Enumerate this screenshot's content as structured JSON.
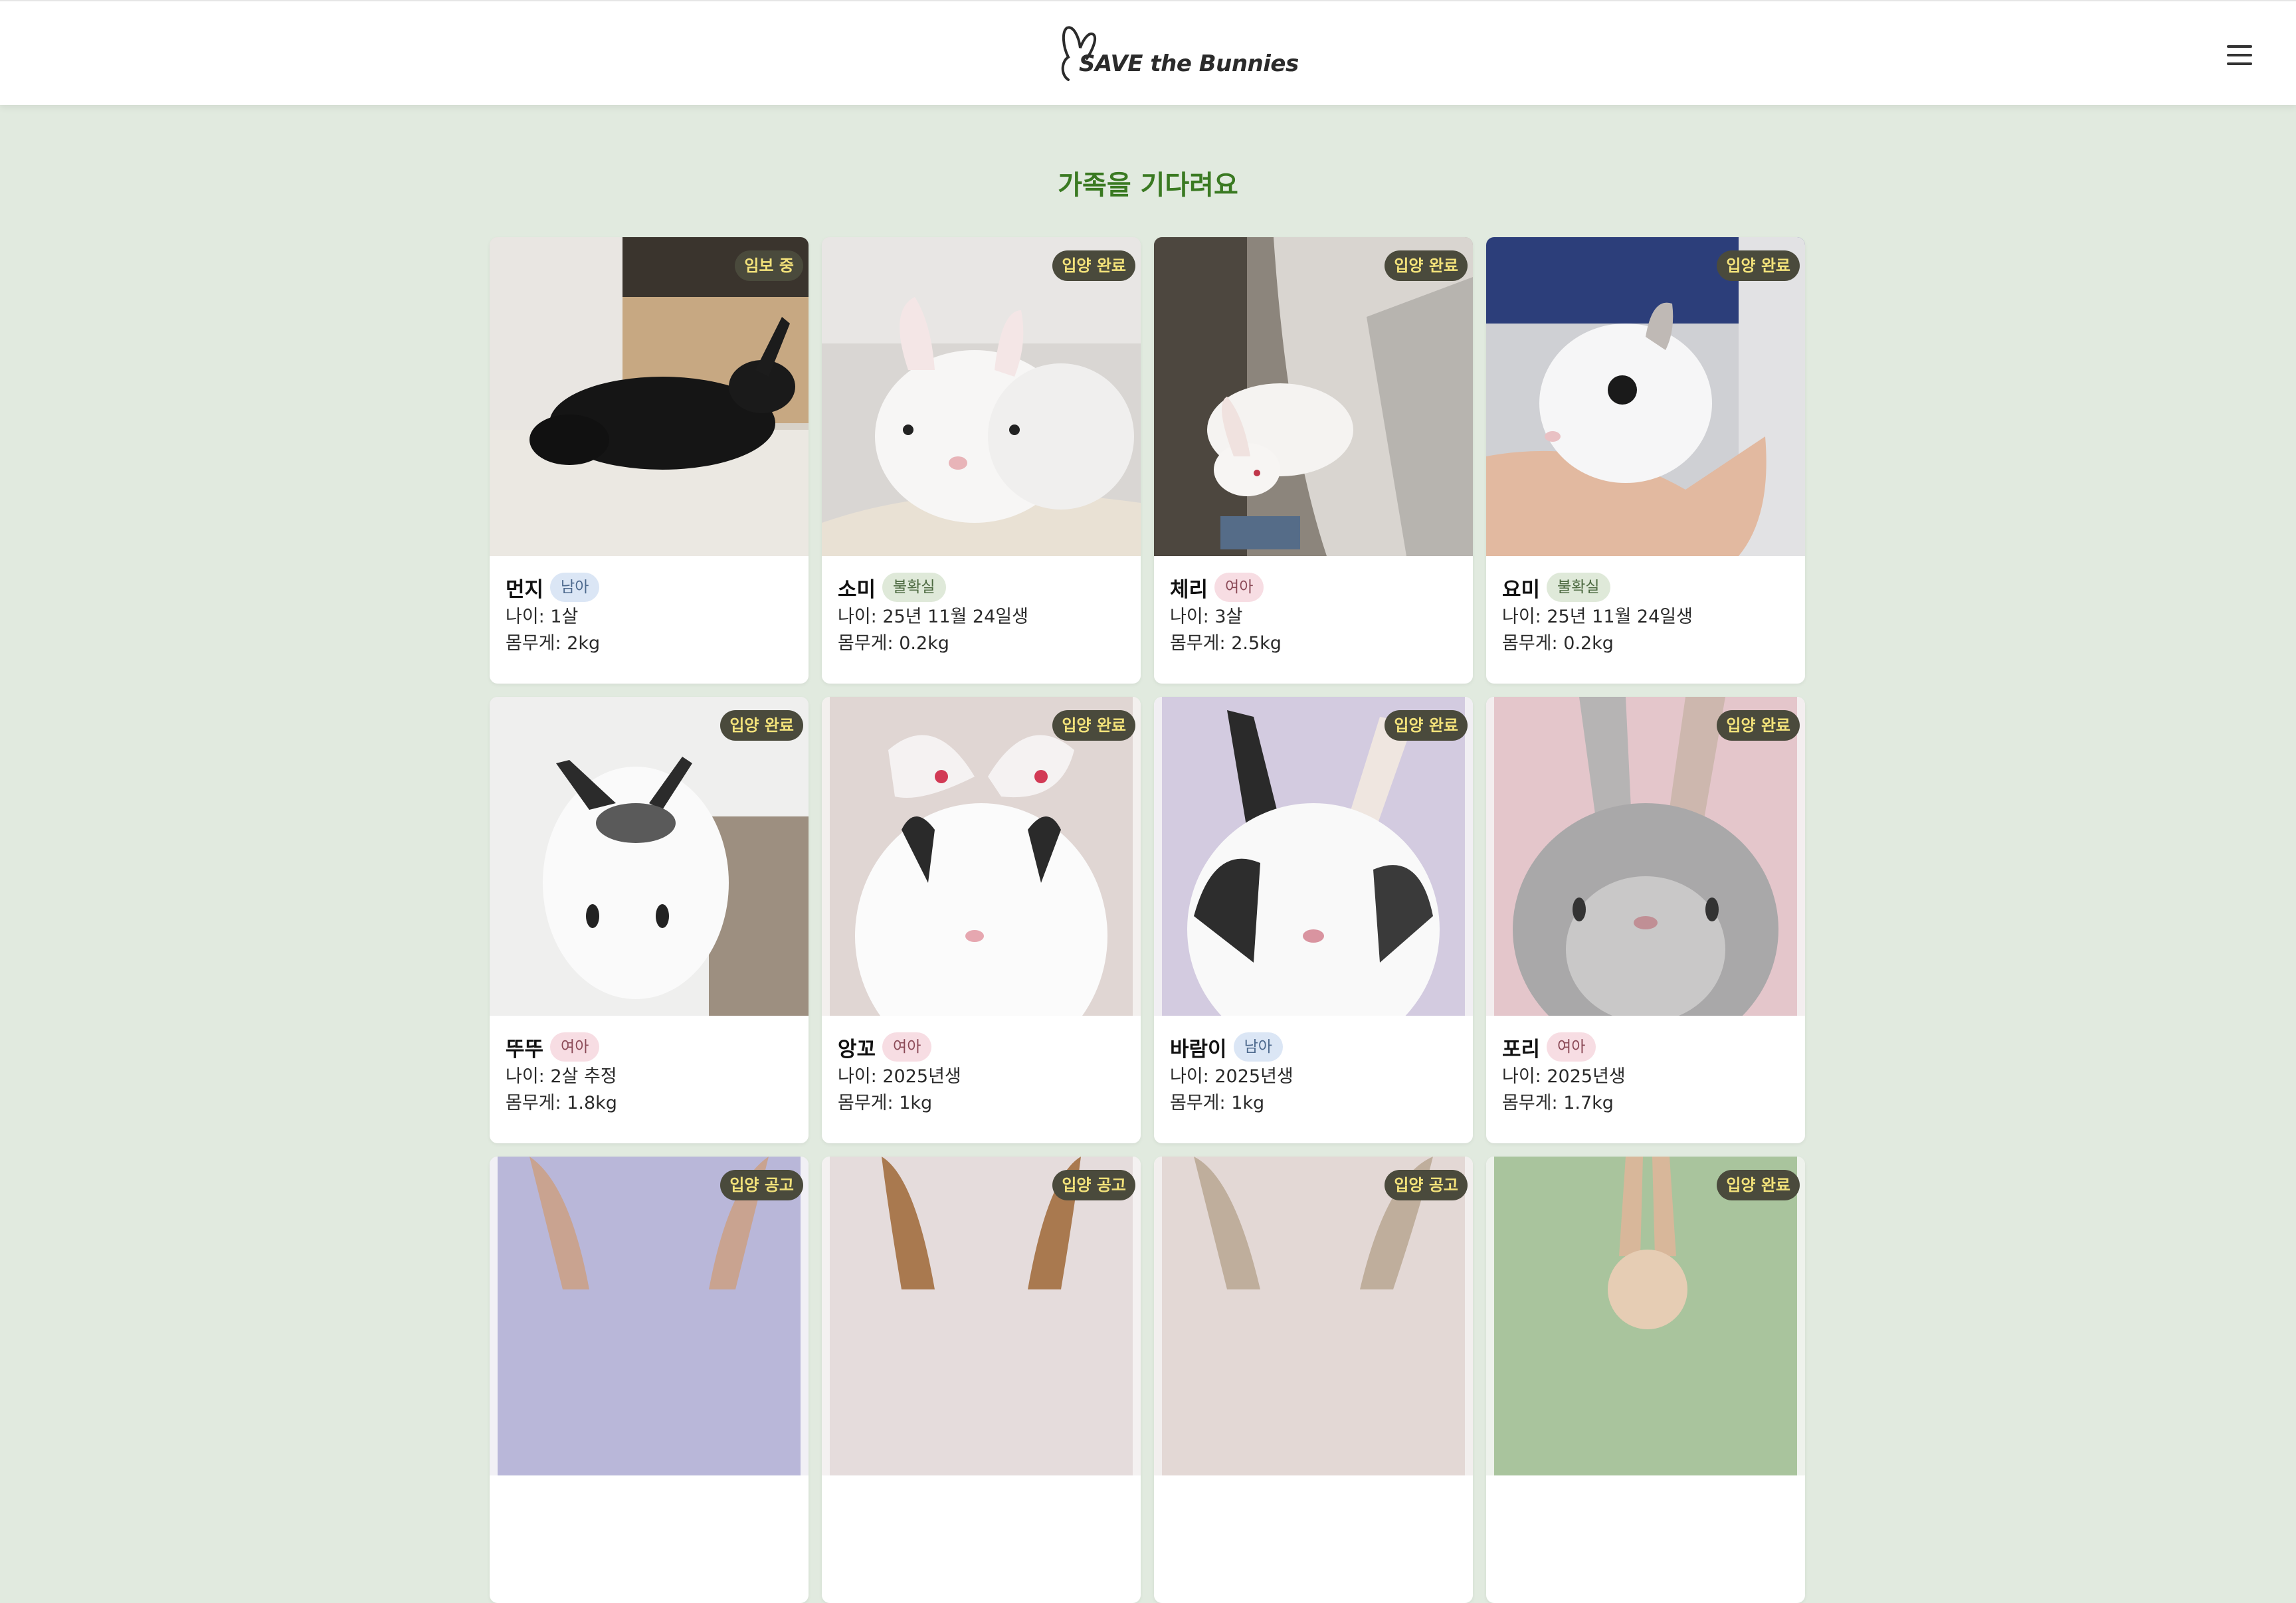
{
  "header": {
    "logo_text": "SAVE the Bunnies",
    "menu_icon": "hamburger-menu-icon"
  },
  "page": {
    "title": "가족을 기다려요"
  },
  "cards": [
    {
      "name": "먼지",
      "tag": "남아",
      "tag_type": "male",
      "status": "임보 중",
      "age": "나이: 1살",
      "weight": "몸무게: 2kg"
    },
    {
      "name": "소미",
      "tag": "불확실",
      "tag_type": "unknown",
      "status": "입양 완료",
      "age": "나이: 25년 11월 24일생",
      "weight": "몸무게: 0.2kg"
    },
    {
      "name": "체리",
      "tag": "여아",
      "tag_type": "female",
      "status": "입양 완료",
      "age": "나이: 3살",
      "weight": "몸무게: 2.5kg"
    },
    {
      "name": "요미",
      "tag": "불확실",
      "tag_type": "unknown",
      "status": "입양 완료",
      "age": "나이: 25년 11월 24일생",
      "weight": "몸무게: 0.2kg"
    },
    {
      "name": "뚜뚜",
      "tag": "여아",
      "tag_type": "female",
      "status": "입양 완료",
      "age": "나이: 2살 추정",
      "weight": "몸무게: 1.8kg"
    },
    {
      "name": "앙꼬",
      "tag": "여아",
      "tag_type": "female",
      "status": "입양 완료",
      "age": "나이: 2025년생",
      "weight": "몸무게: 1kg"
    },
    {
      "name": "바람이",
      "tag": "남아",
      "tag_type": "male",
      "status": "입양 완료",
      "age": "나이: 2025년생",
      "weight": "몸무게: 1kg"
    },
    {
      "name": "포리",
      "tag": "여아",
      "tag_type": "female",
      "status": "입양 완료",
      "age": "나이: 2025년생",
      "weight": "몸무게: 1.7kg"
    },
    {
      "name": "",
      "tag": "",
      "tag_type": "",
      "status": "입양 공고",
      "age": "",
      "weight": ""
    },
    {
      "name": "",
      "tag": "",
      "tag_type": "",
      "status": "입양 공고",
      "age": "",
      "weight": ""
    },
    {
      "name": "",
      "tag": "",
      "tag_type": "",
      "status": "입양 공고",
      "age": "",
      "weight": ""
    },
    {
      "name": "",
      "tag": "",
      "tag_type": "",
      "status": "입양 완료",
      "age": "",
      "weight": ""
    }
  ],
  "colors": {
    "page_background": "#e1eadf",
    "title_green": "#3a7a22",
    "badge_background": "#4a4a3c",
    "badge_text": "#f3e27a"
  }
}
